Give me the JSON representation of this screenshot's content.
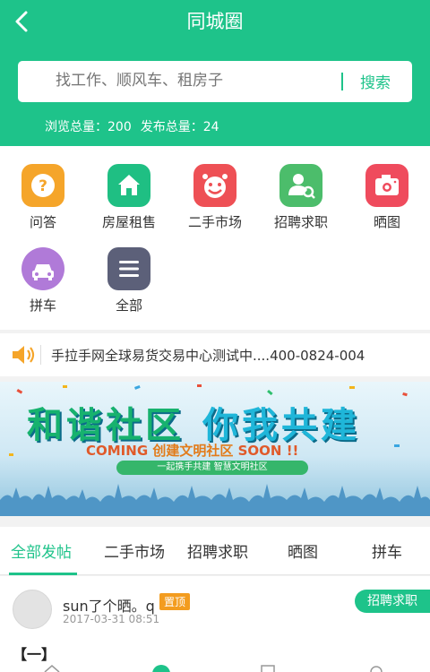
{
  "header": {
    "title": "同城圈",
    "search": {
      "placeholder": "找工作、顺风车、租房子",
      "button": "搜索"
    },
    "stats": {
      "views": "浏览总量：200",
      "posts": "发布总量：24"
    }
  },
  "categories": [
    {
      "label": "问答",
      "icon": "question-icon",
      "color": "#f5a52a"
    },
    {
      "label": "房屋租售",
      "icon": "house-icon",
      "color": "#1fbf83"
    },
    {
      "label": "二手市场",
      "icon": "clown-icon",
      "color": "#ee5055"
    },
    {
      "label": "招聘求职",
      "icon": "recruit-icon",
      "color": "#4cbd6b"
    },
    {
      "label": "晒图",
      "icon": "camera-icon",
      "color": "#ef4b5d"
    },
    {
      "label": "拼车",
      "icon": "car-icon",
      "color": "#b07ad8"
    },
    {
      "label": "全部",
      "icon": "menu-icon",
      "color": "#5c6079"
    }
  ],
  "notice": {
    "text": "手拉手网全球易货交易中心测试中....400-0824-004"
  },
  "banner": {
    "headline_a": "和谐社区",
    "headline_b": "你我共建",
    "sub_a": "COMING",
    "sub_mid": "创建文明社区",
    "sub_b": "SOON !!",
    "pill": "一起携手共建 智慧文明社区"
  },
  "tabs": [
    "全部发帖",
    "二手市场",
    "招聘求职",
    "晒图",
    "拼车"
  ],
  "post": {
    "user": "sun了个晒。q",
    "pin": "置顶",
    "time": "2017-03-31 08:51",
    "category": "招聘求职",
    "body": "【一】"
  },
  "colors": {
    "brand": "#1ec38a"
  }
}
